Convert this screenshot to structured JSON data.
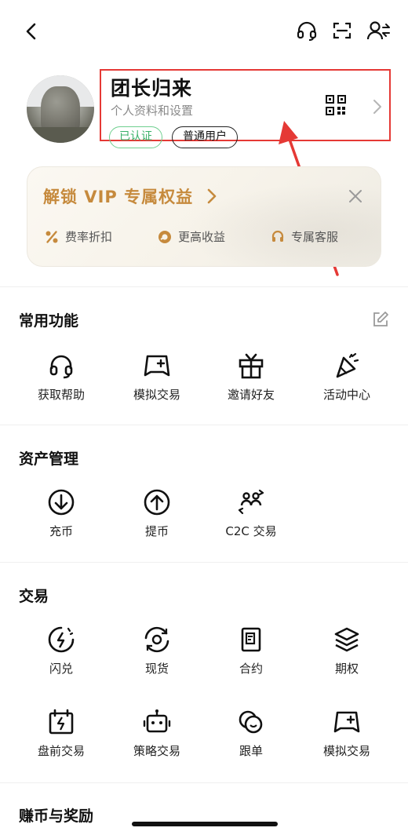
{
  "header": {
    "back_icon": "chevron-left-icon",
    "support_icon": "headset-icon",
    "scan_icon": "scan-icon",
    "account_icon": "account-switch-icon"
  },
  "profile": {
    "name": "团长归来",
    "subtitle": "个人资料和设置",
    "badge_verified": "已认证",
    "badge_user": "普通用户",
    "qr_icon": "qr-code-icon",
    "colors": {
      "highlight": "#e53935",
      "verified": "#37b067"
    }
  },
  "vip": {
    "title": "解锁 VIP 专属权益",
    "items": [
      {
        "label": "费率折扣",
        "icon": "percent-icon"
      },
      {
        "label": "更高收益",
        "icon": "coin-icon"
      },
      {
        "label": "专属客服",
        "icon": "support-icon"
      }
    ],
    "accent": "#c68a3d"
  },
  "sections": {
    "common": {
      "title": "常用功能",
      "items": [
        {
          "label": "获取帮助",
          "icon": "headset-icon"
        },
        {
          "label": "模拟交易",
          "icon": "gamepad-icon"
        },
        {
          "label": "邀请好友",
          "icon": "gift-icon"
        },
        {
          "label": "活动中心",
          "icon": "party-popper-icon"
        }
      ]
    },
    "assets": {
      "title": "资产管理",
      "items": [
        {
          "label": "充币",
          "icon": "deposit-icon"
        },
        {
          "label": "提币",
          "icon": "withdraw-icon"
        },
        {
          "label": "C2C 交易",
          "icon": "c2c-icon"
        }
      ]
    },
    "trade": {
      "title": "交易",
      "items": [
        {
          "label": "闪兑",
          "icon": "flash-convert-icon"
        },
        {
          "label": "现货",
          "icon": "spot-icon"
        },
        {
          "label": "合约",
          "icon": "contract-icon"
        },
        {
          "label": "期权",
          "icon": "layers-icon"
        },
        {
          "label": "盘前交易",
          "icon": "pre-market-icon"
        },
        {
          "label": "策略交易",
          "icon": "robot-icon"
        },
        {
          "label": "跟单",
          "icon": "copy-trade-icon"
        },
        {
          "label": "模拟交易",
          "icon": "gamepad-icon"
        }
      ]
    },
    "earn": {
      "title": "赚币与奖励"
    }
  }
}
